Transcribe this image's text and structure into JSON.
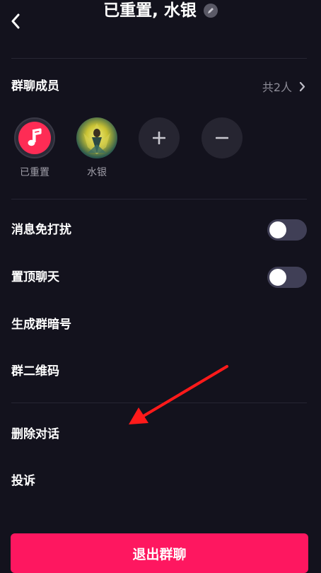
{
  "header": {
    "title": "已重置, 水银"
  },
  "members": {
    "section_label": "群聊成员",
    "count_text": "共2人",
    "list": [
      {
        "name": "已重置"
      },
      {
        "name": "水银"
      }
    ]
  },
  "settings": {
    "mute_label": "消息免打扰",
    "mute_on": false,
    "pin_label": "置顶聊天",
    "pin_on": false,
    "password_label": "生成群暗号",
    "qr_label": "群二维码",
    "delete_label": "删除对话",
    "report_label": "投诉"
  },
  "footer": {
    "exit_label": "退出群聊"
  },
  "colors": {
    "background": "#13121d",
    "accent": "#fe1760",
    "annotation_arrow": "#ff1a1a"
  }
}
